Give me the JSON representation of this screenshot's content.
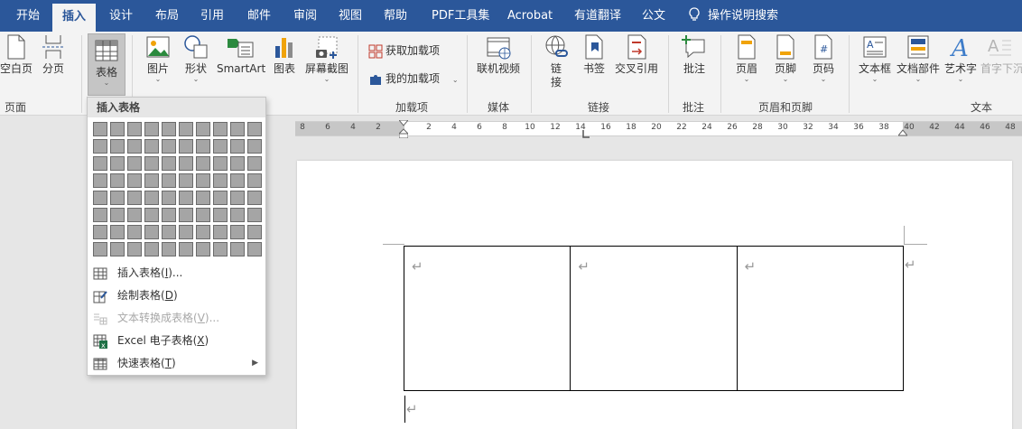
{
  "tabs": [
    "开始",
    "插入",
    "设计",
    "布局",
    "引用",
    "邮件",
    "审阅",
    "视图",
    "帮助",
    "PDF工具集",
    "Acrobat",
    "有道翻译",
    "公文"
  ],
  "active_tab": "插入",
  "tell_me": "操作说明搜索",
  "ribbon": {
    "pages": {
      "blank_page": "空白页",
      "page_break": "分页",
      "group": "页面"
    },
    "table": {
      "label": "表格"
    },
    "illustrations": {
      "pictures": "图片",
      "shapes": "形状",
      "smartart": "SmartArt",
      "chart": "图表",
      "screenshot": "屏幕截图"
    },
    "addins": {
      "get": "获取加载项",
      "mine": "我的加载项",
      "group": "加载项"
    },
    "media": {
      "online_video": "联机视频",
      "group": "媒体"
    },
    "links": {
      "link": "链接",
      "bookmark": "书签",
      "cross_ref": "交叉引用",
      "group": "链接"
    },
    "comments": {
      "comment": "批注",
      "group": "批注"
    },
    "header_footer": {
      "header": "页眉",
      "footer": "页脚",
      "page_number": "页码",
      "group": "页眉和页脚"
    },
    "text": {
      "textbox": "文本框",
      "quick_parts": "文档部件",
      "wordart": "艺术字",
      "dropcap": "首字下沉",
      "group": "文本"
    }
  },
  "dropdown": {
    "title": "插入表格",
    "grid_cols": 10,
    "grid_rows": 8,
    "items": [
      {
        "label": "插入表格(",
        "key": "I",
        "suffix": ")...",
        "enabled": true
      },
      {
        "label": "绘制表格(",
        "key": "D",
        "suffix": ")",
        "enabled": true
      },
      {
        "label": "文本转换成表格(",
        "key": "V",
        "suffix": ")...",
        "enabled": false
      },
      {
        "label": "Excel 电子表格(",
        "key": "X",
        "suffix": ")",
        "enabled": true
      },
      {
        "label": "快速表格(",
        "key": "T",
        "suffix": ")",
        "enabled": true,
        "submenu": true
      }
    ]
  },
  "ruler_ticks": [
    "8",
    "6",
    "4",
    "2",
    "2",
    "4",
    "6",
    "8",
    "10",
    "12",
    "14",
    "16",
    "18",
    "20",
    "22",
    "24",
    "26",
    "28",
    "30",
    "32",
    "34",
    "36",
    "38",
    "40",
    "42",
    "44",
    "46",
    "48"
  ],
  "document": {
    "paragraph_mark": "↵",
    "table_rows": 1,
    "table_cols": 3
  },
  "colors": {
    "brand": "#2b579a",
    "ribbon_bg": "#f3f3f3",
    "grid_cell": "#a5a5a5"
  }
}
